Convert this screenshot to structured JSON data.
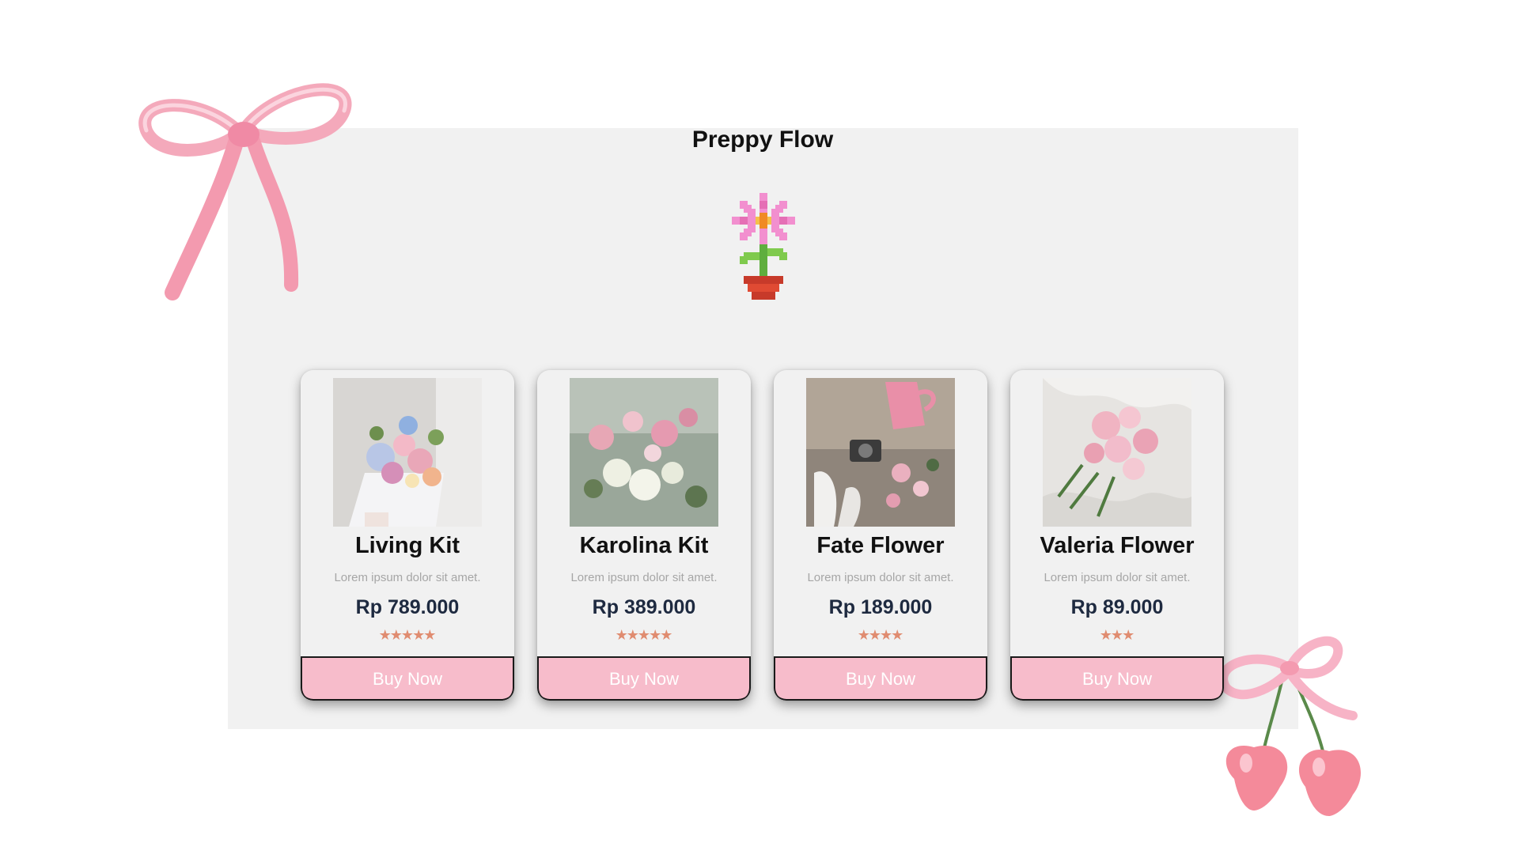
{
  "app": {
    "title": "Preppy Flow"
  },
  "theme": {
    "panel_bg": "#f1f1f1",
    "button_bg": "#f7bccb",
    "button_text": "#ffffff",
    "star_color": "#e08c70",
    "price_color": "#1e2a40"
  },
  "decorations": {
    "logo_icon": "pixel-flower-pot-icon",
    "top_left": "pink-ribbon-bow",
    "bottom_right": "pink-cherries-with-bow"
  },
  "products": [
    {
      "name": "Living Kit",
      "description": "Lorem ipsum dolor sit amet.",
      "price": "Rp 789.000",
      "rating": 5,
      "button_label": "Buy Now",
      "image": "mixed pastel bouquet"
    },
    {
      "name": "Karolina Kit",
      "description": "Lorem ipsum dolor sit amet.",
      "price": "Rp 389.000",
      "rating": 5,
      "button_label": "Buy Now",
      "image": "pink and white rose bouquet"
    },
    {
      "name": "Fate Flower",
      "description": "Lorem ipsum dolor sit amet.",
      "price": "Rp 189.000",
      "rating": 4,
      "button_label": "Buy Now",
      "image": "pink flowers with camera and watering can"
    },
    {
      "name": "Valeria Flower",
      "description": "Lorem ipsum dolor sit amet.",
      "price": "Rp 89.000",
      "rating": 3,
      "button_label": "Buy Now",
      "image": "pink carnations on white fabric"
    }
  ]
}
